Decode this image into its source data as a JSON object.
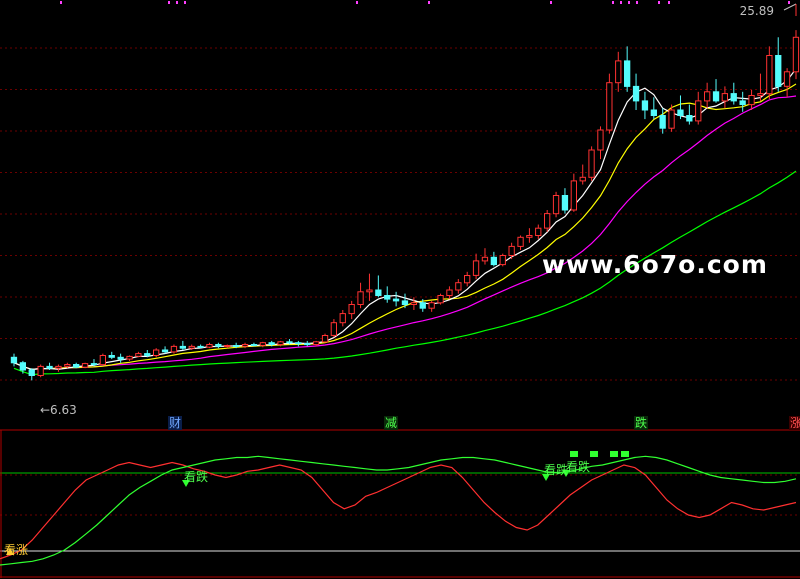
{
  "chart_data": [
    {
      "type": "candlestick",
      "title": "",
      "price_high_label": "25.89",
      "price_low_label": "←6.63",
      "y_range": [
        5,
        27
      ],
      "colors": {
        "up": "#ff3232",
        "down": "#54fcfc",
        "ma5": "#ffffff",
        "ma10": "#ffff00",
        "ma20": "#ff00ff",
        "ma60": "#00ff00"
      },
      "candles": [
        [
          7.9,
          8.1,
          7.4,
          7.6
        ],
        [
          7.6,
          7.7,
          7.0,
          7.2
        ],
        [
          7.2,
          7.3,
          6.63,
          6.9
        ],
        [
          6.9,
          7.5,
          6.8,
          7.4
        ],
        [
          7.4,
          7.6,
          7.2,
          7.3
        ],
        [
          7.3,
          7.5,
          7.1,
          7.4
        ],
        [
          7.4,
          7.6,
          7.3,
          7.5
        ],
        [
          7.5,
          7.6,
          7.3,
          7.35
        ],
        [
          7.35,
          7.6,
          7.3,
          7.55
        ],
        [
          7.55,
          7.8,
          7.4,
          7.5
        ],
        [
          7.5,
          8.1,
          7.5,
          8.0
        ],
        [
          8.0,
          8.2,
          7.8,
          7.9
        ],
        [
          7.9,
          8.1,
          7.6,
          7.8
        ],
        [
          7.8,
          8.0,
          7.7,
          7.95
        ],
        [
          7.95,
          8.2,
          7.9,
          8.1
        ],
        [
          8.1,
          8.3,
          7.9,
          8.0
        ],
        [
          8.0,
          8.4,
          7.9,
          8.3
        ],
        [
          8.3,
          8.5,
          8.1,
          8.2
        ],
        [
          8.2,
          8.6,
          8.1,
          8.5
        ],
        [
          8.5,
          8.8,
          8.3,
          8.4
        ],
        [
          8.4,
          8.6,
          8.3,
          8.5
        ],
        [
          8.5,
          8.6,
          8.4,
          8.45
        ],
        [
          8.45,
          8.7,
          8.4,
          8.6
        ],
        [
          8.6,
          8.7,
          8.4,
          8.5
        ],
        [
          8.5,
          8.6,
          8.4,
          8.55
        ],
        [
          8.55,
          8.7,
          8.4,
          8.5
        ],
        [
          8.5,
          8.7,
          8.4,
          8.6
        ],
        [
          8.6,
          8.7,
          8.5,
          8.55
        ],
        [
          8.55,
          8.75,
          8.45,
          8.7
        ],
        [
          8.7,
          8.8,
          8.5,
          8.6
        ],
        [
          8.6,
          8.8,
          8.5,
          8.75
        ],
        [
          8.75,
          8.9,
          8.6,
          8.7
        ],
        [
          8.7,
          8.8,
          8.5,
          8.65
        ],
        [
          8.65,
          8.8,
          8.5,
          8.6
        ],
        [
          8.6,
          8.8,
          8.5,
          8.75
        ],
        [
          8.75,
          9.2,
          8.7,
          9.1
        ],
        [
          9.1,
          10.0,
          9.0,
          9.8
        ],
        [
          9.8,
          10.5,
          9.6,
          10.3
        ],
        [
          10.3,
          11.0,
          10.0,
          10.8
        ],
        [
          10.8,
          12.0,
          10.6,
          11.5
        ],
        [
          11.5,
          12.5,
          11.0,
          11.6
        ],
        [
          11.6,
          12.4,
          11.2,
          11.3
        ],
        [
          11.3,
          11.8,
          10.9,
          11.1
        ],
        [
          11.1,
          11.5,
          10.7,
          11.0
        ],
        [
          11.0,
          11.4,
          10.6,
          10.8
        ],
        [
          10.8,
          11.2,
          10.5,
          10.9
        ],
        [
          10.9,
          11.1,
          10.4,
          10.6
        ],
        [
          10.6,
          11.0,
          10.4,
          10.9
        ],
        [
          10.9,
          11.4,
          10.8,
          11.3
        ],
        [
          11.3,
          11.8,
          11.1,
          11.6
        ],
        [
          11.6,
          12.2,
          11.4,
          12.0
        ],
        [
          12.0,
          12.6,
          11.8,
          12.4
        ],
        [
          12.4,
          13.6,
          12.2,
          13.2
        ],
        [
          13.2,
          13.9,
          13.0,
          13.4
        ],
        [
          13.4,
          13.7,
          12.9,
          13.0
        ],
        [
          13.0,
          13.6,
          12.9,
          13.5
        ],
        [
          13.5,
          14.2,
          13.3,
          14.0
        ],
        [
          14.0,
          14.6,
          13.8,
          14.5
        ],
        [
          14.5,
          15.0,
          14.2,
          14.6
        ],
        [
          14.6,
          15.2,
          14.4,
          15.0
        ],
        [
          15.0,
          16.0,
          14.8,
          15.8
        ],
        [
          15.8,
          17.0,
          15.6,
          16.8
        ],
        [
          16.8,
          17.2,
          15.8,
          16.0
        ],
        [
          16.0,
          18.0,
          15.9,
          17.6
        ],
        [
          17.6,
          18.5,
          17.4,
          17.8
        ],
        [
          17.8,
          19.5,
          17.6,
          19.3
        ],
        [
          19.3,
          20.6,
          18.8,
          20.4
        ],
        [
          20.4,
          23.5,
          20.2,
          23.0
        ],
        [
          23.0,
          24.7,
          22.5,
          24.2
        ],
        [
          24.2,
          25.0,
          22.5,
          22.8
        ],
        [
          22.8,
          23.5,
          21.5,
          22.0
        ],
        [
          22.0,
          22.5,
          21.0,
          21.5
        ],
        [
          21.5,
          22.2,
          21.0,
          21.2
        ],
        [
          21.2,
          21.6,
          20.2,
          20.5
        ],
        [
          20.5,
          21.8,
          20.3,
          21.5
        ],
        [
          21.5,
          22.3,
          21.0,
          21.2
        ],
        [
          21.2,
          21.8,
          20.7,
          20.9
        ],
        [
          20.9,
          22.5,
          20.7,
          22.0
        ],
        [
          22.0,
          23.0,
          21.6,
          22.5
        ],
        [
          22.5,
          23.2,
          21.9,
          22.0
        ],
        [
          22.0,
          22.8,
          21.6,
          22.4
        ],
        [
          22.4,
          23.0,
          21.8,
          22.0
        ],
        [
          22.0,
          22.5,
          21.4,
          21.8
        ],
        [
          21.8,
          22.6,
          21.5,
          22.3
        ],
        [
          22.3,
          23.5,
          22.0,
          22.4
        ],
        [
          22.4,
          25.0,
          22.1,
          24.5
        ],
        [
          24.5,
          25.5,
          22.5,
          22.8
        ],
        [
          22.8,
          23.8,
          22.2,
          23.6
        ],
        [
          23.6,
          25.89,
          23.2,
          25.5
        ]
      ]
    },
    {
      "type": "line",
      "title": "",
      "y_range": [
        0,
        100
      ],
      "series": [
        {
          "color": "#ff3030",
          "values": [
            5,
            8,
            12,
            20,
            30,
            40,
            50,
            60,
            68,
            72,
            76,
            80,
            82,
            80,
            78,
            80,
            82,
            80,
            77,
            75,
            72,
            70,
            72,
            75,
            76,
            78,
            80,
            78,
            76,
            70,
            60,
            50,
            45,
            48,
            55,
            58,
            62,
            66,
            70,
            74,
            78,
            80,
            78,
            70,
            60,
            50,
            42,
            35,
            30,
            28,
            32,
            40,
            48,
            56,
            62,
            68,
            72,
            76,
            80,
            78,
            72,
            62,
            52,
            45,
            40,
            38,
            40,
            45,
            50,
            48,
            45,
            44,
            46,
            48,
            50
          ]
        },
        {
          "color": "#30ff30",
          "values": [
            0,
            1,
            2,
            3,
            5,
            8,
            12,
            18,
            25,
            32,
            40,
            48,
            56,
            62,
            67,
            72,
            76,
            78,
            80,
            82,
            84,
            85,
            86,
            86,
            87,
            86,
            85,
            84,
            83,
            82,
            81,
            80,
            79,
            78,
            77,
            76,
            76,
            77,
            78,
            80,
            82,
            84,
            85,
            86,
            86,
            85,
            84,
            82,
            80,
            78,
            76,
            74,
            74,
            75,
            77,
            79,
            80,
            82,
            84,
            86,
            87,
            86,
            84,
            81,
            78,
            75,
            72,
            70,
            69,
            68,
            67,
            66,
            66,
            67,
            69
          ]
        }
      ],
      "signals": [
        {
          "label": "看跌",
          "kind": "down-arrow"
        },
        {
          "label": "看跌",
          "kind": "down-arrow"
        },
        {
          "label": "看跌",
          "kind": "down-arrow"
        },
        {
          "label": "看涨",
          "kind": "up-arrow"
        }
      ]
    }
  ],
  "event_tags": [
    {
      "label": "财",
      "style": "t-blue"
    },
    {
      "label": "减",
      "style": "t-green"
    },
    {
      "label": "跌",
      "style": "t-green"
    },
    {
      "label": "涨",
      "style": "t-red"
    }
  ],
  "watermark": "www.6o7o.com"
}
